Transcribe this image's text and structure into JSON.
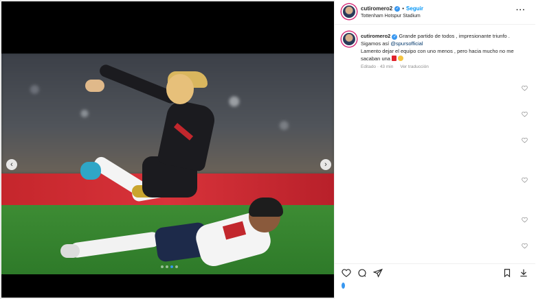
{
  "post": {
    "username": "cutiromero2",
    "follow_label": "Seguir",
    "separator": "•",
    "location": "Tottenham Hotspur Stadium",
    "more_label": "···"
  },
  "caption": {
    "username": "cutiromero2",
    "line1": "Grande partido de todos , impresionante triunfo . Sigamos así",
    "mention": "@spursofficial",
    "line2": "Lamento dejar el equipo con uno menos , pero hacia mucho no me sacaban una",
    "edited": "Editado · 43 min",
    "translate_label": "Ver traducción"
  },
  "media": {
    "prev_label": "‹",
    "next_label": "›",
    "dot_count": 4,
    "active_dot": 2
  },
  "icons": [
    "heart-icon",
    "comment-icon",
    "share-icon",
    "bookmark-icon",
    "download-icon",
    "chevron-left-icon",
    "chevron-right-icon",
    "verified-icon",
    "more-icon"
  ],
  "colors": {
    "accent": "#0095f6",
    "verified": "#3897f0",
    "text": "#262626",
    "muted": "#8e8e8e"
  }
}
